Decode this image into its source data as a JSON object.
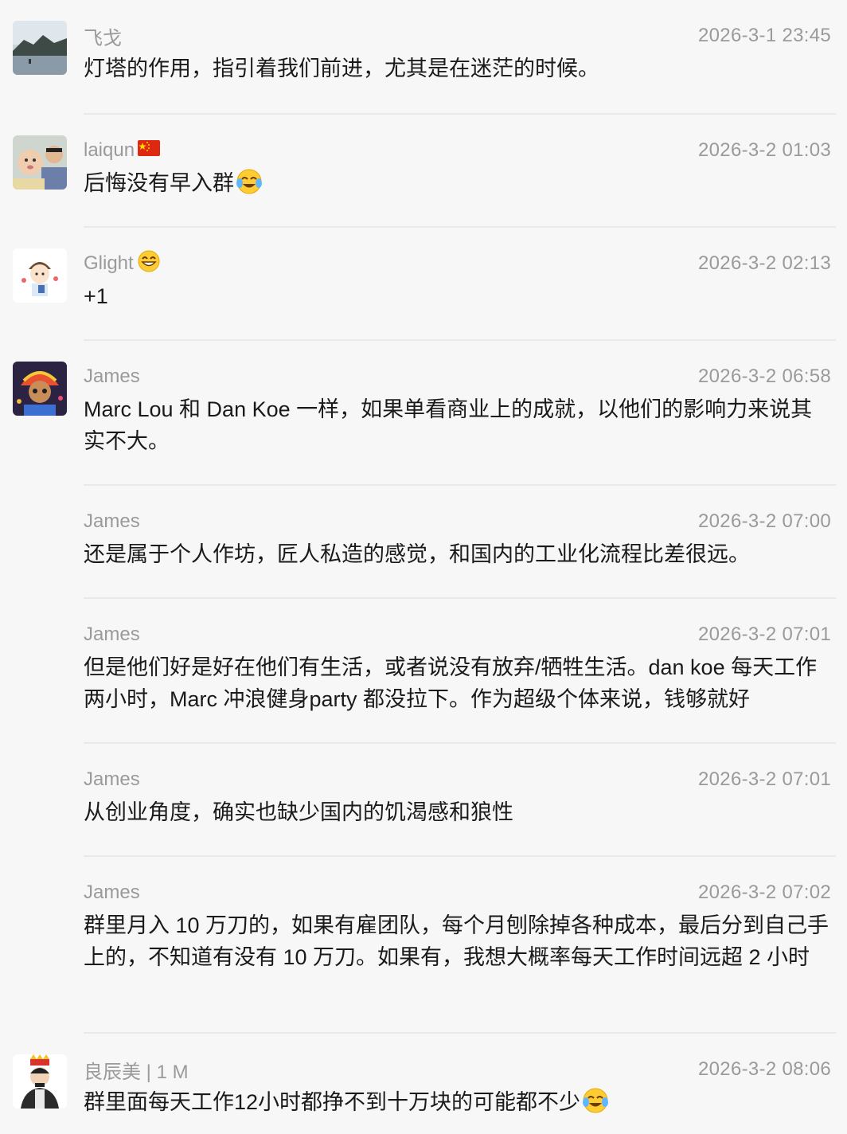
{
  "messages": [
    {
      "name": "飞戈",
      "time": "2026-3-1 23:45",
      "text": "灯塔的作用，指引着我们前进，尤其是在迷茫的时候。",
      "avatar": "landscape-avatar"
    },
    {
      "name": "laiqun",
      "time": "2026-3-2 01:03",
      "text": "后悔没有早入群",
      "avatar": "child-photo-avatar",
      "name_icon": "china-flag-icon",
      "text_icon": "crying-laughing-emoji"
    },
    {
      "name": "Glight",
      "time": "2026-3-2 02:13",
      "text": "+1",
      "avatar": "cartoon-boy-avatar",
      "name_icon": "grinning-emoji"
    },
    {
      "name": "James",
      "time": "2026-3-2 06:58",
      "text": "Marc Lou 和 Dan Koe 一样，如果单看商业上的成就，以他们的影响力来说其实不大。",
      "avatar": "colorful-character-avatar"
    },
    {
      "name": "James",
      "time": "2026-3-2 07:00",
      "text": "还是属于个人作坊，匠人私造的感觉，和国内的工业化流程比差很远。"
    },
    {
      "name": "James",
      "time": "2026-3-2 07:01",
      "text": "但是他们好是好在他们有生活，或者说没有放弃/牺牲生活。dan koe 每天工作两小时，Marc 冲浪健身party 都没拉下。作为超级个体来说，钱够就好"
    },
    {
      "name": "James",
      "time": "2026-3-2 07:01",
      "text": "从创业角度，确实也缺少国内的饥渴感和狼性"
    },
    {
      "name": "James",
      "time": "2026-3-2 07:02",
      "text": "群里月入 10 万刀的，如果有雇团队，每个月刨除掉各种成本，最后分到自己手上的，不知道有没有 10 万刀。如果有，我想大概率每天工作时间远超 2 小时"
    },
    {
      "name": "良辰美 | 1 M",
      "time": "2026-3-2 08:06",
      "text": "群里面每天工作12小时都挣不到十万块的可能都不少",
      "avatar": "man-with-crown-avatar",
      "text_icon": "crying-laughing-emoji"
    }
  ]
}
